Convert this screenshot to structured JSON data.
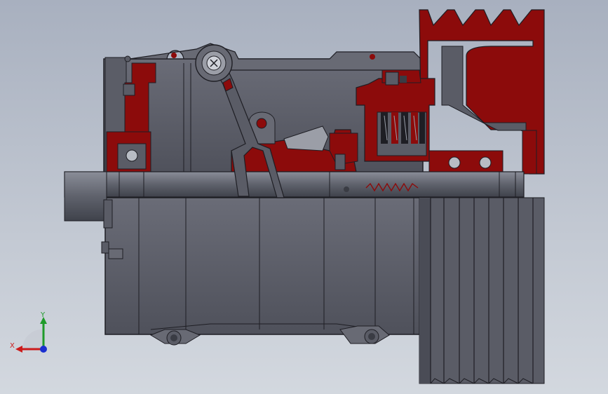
{
  "viewport": {
    "background_top": "#a8b0bf",
    "background_bottom": "#d3d8df"
  },
  "model": {
    "section_color": "#8c0b0b",
    "body_color": "#5e606b",
    "edge_color": "#1e1e24",
    "shaft_color": "#6a6d78"
  },
  "triad": {
    "x_label": "X",
    "y_label": "Y",
    "x_color": "#cc1b1b",
    "y_color": "#1f9b2a",
    "z_color": "#1a2fd0"
  }
}
